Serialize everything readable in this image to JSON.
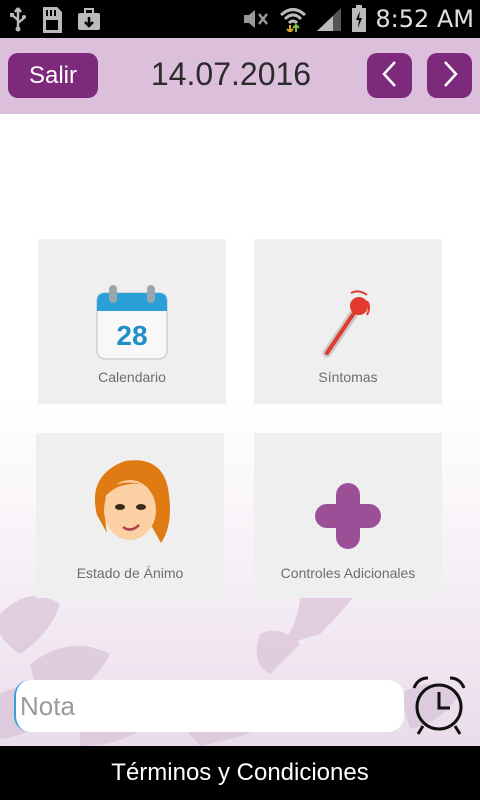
{
  "status_bar": {
    "time": "8:52 AM",
    "icons": [
      "usb-icon",
      "sd-card-icon",
      "briefcase-icon",
      "mute-icon",
      "wifi-icon",
      "signal-icon",
      "battery-icon"
    ]
  },
  "header": {
    "exit_label": "Salir",
    "date": "14.07.2016",
    "prev_icon": "chevron-left-icon",
    "next_icon": "chevron-right-icon"
  },
  "tiles": [
    {
      "label": "Calendario",
      "icon": "calendar-icon",
      "day": "28"
    },
    {
      "label": "Síntomas",
      "icon": "thermometer-icon"
    },
    {
      "label": "Estado de Ánimo",
      "icon": "mood-face-icon"
    },
    {
      "label": "Controles Adicionales",
      "icon": "plus-icon"
    }
  ],
  "note": {
    "placeholder": "Nota"
  },
  "footer": {
    "terms_label": "Términos y Condiciones"
  },
  "colors": {
    "brand": "#7e2a7c",
    "header_bg": "#dcbfdb",
    "tile_bg": "#efefef"
  }
}
